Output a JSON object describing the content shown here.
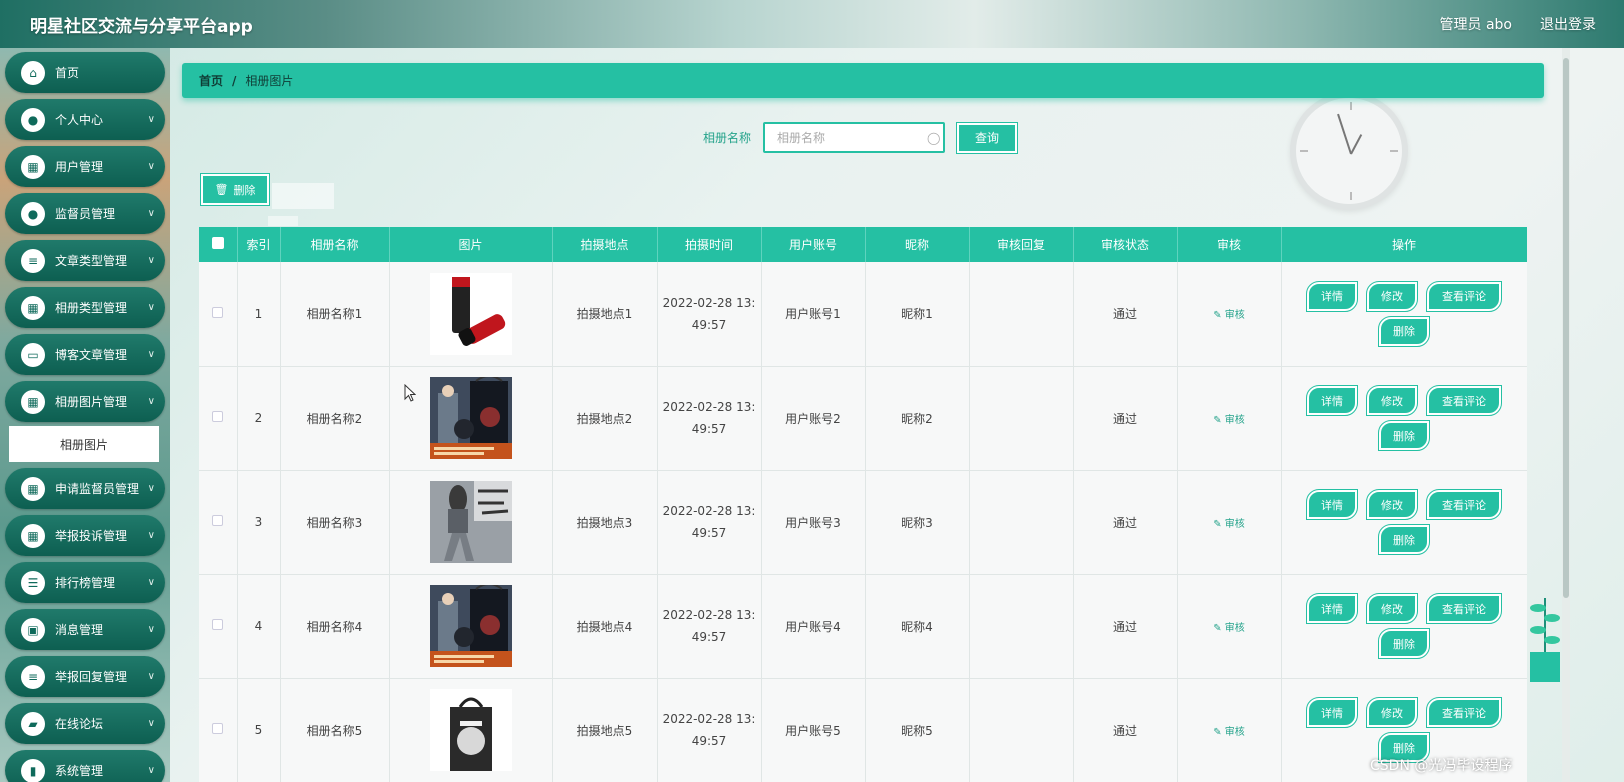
{
  "header": {
    "app_title": "明星社区交流与分享平台app",
    "admin_label": "管理员 abo",
    "logout_label": "退出登录"
  },
  "sidebar": {
    "items": [
      {
        "label": "首页",
        "icon": "home-icon",
        "glyph": "⌂",
        "expandable": false
      },
      {
        "label": "个人中心",
        "icon": "user-icon",
        "glyph": "●",
        "expandable": true
      },
      {
        "label": "用户管理",
        "icon": "grid-icon",
        "glyph": "▦",
        "expandable": true
      },
      {
        "label": "监督员管理",
        "icon": "user-icon",
        "glyph": "●",
        "expandable": true
      },
      {
        "label": "文章类型管理",
        "icon": "list-icon",
        "glyph": "≡",
        "expandable": true
      },
      {
        "label": "相册类型管理",
        "icon": "grid-icon",
        "glyph": "▦",
        "expandable": true
      },
      {
        "label": "博客文章管理",
        "icon": "monitor-icon",
        "glyph": "▭",
        "expandable": true
      },
      {
        "label": "相册图片管理",
        "icon": "grid-icon",
        "glyph": "▦",
        "expandable": true
      },
      {
        "label": "申请监督员管理",
        "icon": "grid-icon",
        "glyph": "▦",
        "expandable": true
      },
      {
        "label": "举报投诉管理",
        "icon": "grid-icon",
        "glyph": "▦",
        "expandable": true
      },
      {
        "label": "排行榜管理",
        "icon": "sliders-icon",
        "glyph": "☰",
        "expandable": true
      },
      {
        "label": "消息管理",
        "icon": "clipboard-icon",
        "glyph": "▣",
        "expandable": true
      },
      {
        "label": "举报回复管理",
        "icon": "list-icon",
        "glyph": "≡",
        "expandable": true
      },
      {
        "label": "在线论坛",
        "icon": "wallet-icon",
        "glyph": "▰",
        "expandable": true
      },
      {
        "label": "系统管理",
        "icon": "chart-icon",
        "glyph": "▮",
        "expandable": true
      }
    ],
    "active_submenu": "相册图片"
  },
  "breadcrumb": {
    "home": "首页",
    "separator": "/",
    "current": "相册图片"
  },
  "search": {
    "label": "相册名称",
    "placeholder": "相册名称",
    "value": "",
    "button": "查询"
  },
  "toolbar": {
    "delete_label": "删除"
  },
  "table": {
    "columns": [
      "索引",
      "相册名称",
      "图片",
      "拍摄地点",
      "拍摄时间",
      "用户账号",
      "昵称",
      "审核回复",
      "审核状态",
      "审核",
      "操作"
    ],
    "audit_link": "审核",
    "ops": {
      "detail": "详情",
      "edit": "修改",
      "comments": "查看评论",
      "delete": "删除"
    },
    "rows": [
      {
        "index": "1",
        "name": "相册名称1",
        "image": "thermos",
        "location": "拍摄地点1",
        "time_a": "2022-02-28 13:",
        "time_b": "49:57",
        "account": "用户账号1",
        "nickname": "昵称1",
        "reply": "",
        "status": "通过"
      },
      {
        "index": "2",
        "name": "相册名称2",
        "image": "giftbox",
        "location": "拍摄地点2",
        "time_a": "2022-02-28 13:",
        "time_b": "49:57",
        "account": "用户账号2",
        "nickname": "昵称2",
        "reply": "",
        "status": "通过"
      },
      {
        "index": "3",
        "name": "相册名称3",
        "image": "fashion",
        "location": "拍摄地点3",
        "time_a": "2022-02-28 13:",
        "time_b": "49:57",
        "account": "用户账号3",
        "nickname": "昵称3",
        "reply": "",
        "status": "通过"
      },
      {
        "index": "4",
        "name": "相册名称4",
        "image": "giftbox",
        "location": "拍摄地点4",
        "time_a": "2022-02-28 13:",
        "time_b": "49:57",
        "account": "用户账号4",
        "nickname": "昵称4",
        "reply": "",
        "status": "通过"
      },
      {
        "index": "5",
        "name": "相册名称5",
        "image": "totebag",
        "location": "拍摄地点5",
        "time_a": "2022-02-28 13:",
        "time_b": "49:57",
        "account": "用户账号5",
        "nickname": "昵称5",
        "reply": "",
        "status": "通过"
      }
    ]
  },
  "watermark": "CSDN @光冯毕设程序",
  "colors": {
    "accent": "#25c0a3",
    "sidebar_item": "#0d5f51",
    "header_text": "#ffffff"
  }
}
